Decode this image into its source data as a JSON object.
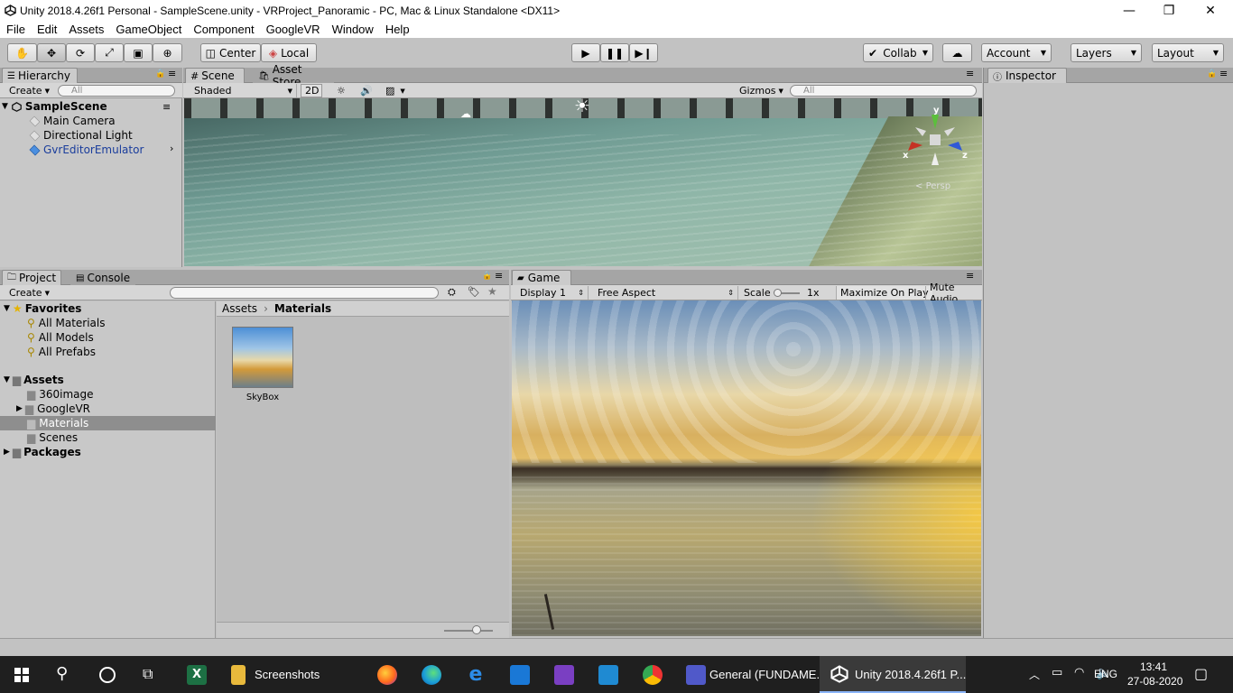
{
  "window": {
    "title": "Unity 2018.4.26f1 Personal - SampleScene.unity - VRProject_Panoramic - PC, Mac & Linux Standalone <DX11>",
    "minimize": "—",
    "restore": "❐",
    "close": "✕"
  },
  "menu": [
    "File",
    "Edit",
    "Assets",
    "GameObject",
    "Component",
    "GoogleVR",
    "Window",
    "Help"
  ],
  "toolbar": {
    "pivot": "Center",
    "space": "Local",
    "collab": "Collab",
    "account": "Account",
    "layers": "Layers",
    "layout": "Layout"
  },
  "hierarchy": {
    "tab": "Hierarchy",
    "create": "Create",
    "search_placeholder": "All",
    "scene": "SampleScene",
    "items": [
      "Main Camera",
      "Directional Light",
      "GvrEditorEmulator"
    ]
  },
  "scene": {
    "tab": "Scene",
    "tab2": "Asset Store",
    "shading": "Shaded",
    "mode2d": "2D",
    "gizmos": "Gizmos",
    "search_placeholder": "All",
    "persp": "Persp",
    "axis_x": "x",
    "axis_y": "y",
    "axis_z": "z"
  },
  "inspector": {
    "tab": "Inspector"
  },
  "project": {
    "tab": "Project",
    "tab2": "Console",
    "create": "Create",
    "favorites": "Favorites",
    "fav_items": [
      "All Materials",
      "All Models",
      "All Prefabs"
    ],
    "assets": "Assets",
    "asset_folders": [
      "360image",
      "GoogleVR",
      "Materials",
      "Scenes"
    ],
    "packages": "Packages",
    "breadcrumb": [
      "Assets",
      "Materials"
    ],
    "file": "SkyBox"
  },
  "game": {
    "tab": "Game",
    "display": "Display 1",
    "aspect": "Free Aspect",
    "scale_label": "Scale",
    "scale_value": "1x",
    "maximize": "Maximize On Play",
    "mute": "Mute Audio"
  },
  "taskbar": {
    "apps": [
      "Screenshots",
      "General (FUNDAME...",
      "Unity 2018.4.26f1 P..."
    ],
    "lang": "ENG",
    "time": "13:41",
    "date": "27-08-2020"
  },
  "colors": {
    "unity_bg": "#c2c2c2",
    "panel_header": "#a5a5a5",
    "taskbar": "#1f1f1f",
    "selection": "#8e8e8e",
    "link_blue": "#1a3d9c"
  }
}
